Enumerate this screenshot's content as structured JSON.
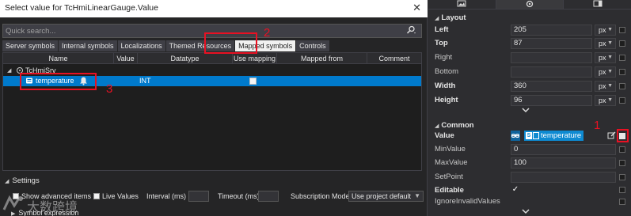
{
  "dialog": {
    "title": "Select value for TcHmiLinearGauge.Value",
    "close": "✕",
    "search_placeholder": "Quick search...",
    "search_icon": "search-icon",
    "tabs": [
      "Server symbols",
      "Internal symbols",
      "Localizations",
      "Themed Resources",
      "Mapped symbols",
      "Controls"
    ],
    "active_tab": "Mapped symbols",
    "columns": [
      "Name",
      "Value",
      "Datatype",
      "Use mapping",
      "Mapped from",
      "Comment"
    ],
    "tree": {
      "server": "TcHmiSrv",
      "symbol": "temperature",
      "datatype": "INT"
    },
    "settings": {
      "header": "Settings",
      "show_advanced": "Show advanced items",
      "live_values": "Live Values",
      "interval_label": "Interval (ms)",
      "timeout_label": "Timeout (ms)",
      "subscription_label": "Subscription Mode:",
      "subscription_value": "Use project default",
      "symbol_expression": "Symbol expression"
    }
  },
  "panel": {
    "tab_icons": [
      "image-icon",
      "settings-icon",
      "layout-icon"
    ],
    "layout": {
      "header": "Layout",
      "fields": [
        {
          "label": "Left",
          "value": "205",
          "unit": "px",
          "bold": true
        },
        {
          "label": "Top",
          "value": "87",
          "unit": "px",
          "bold": true
        },
        {
          "label": "Right",
          "value": "",
          "unit": "px",
          "bold": false
        },
        {
          "label": "Bottom",
          "value": "",
          "unit": "px",
          "bold": false
        },
        {
          "label": "Width",
          "value": "360",
          "unit": "px",
          "bold": true
        },
        {
          "label": "Height",
          "value": "96",
          "unit": "px",
          "bold": true
        }
      ]
    },
    "common": {
      "header": "Common",
      "value_label": "Value",
      "value_symbol": "temperature",
      "fields": [
        {
          "label": "MinValue",
          "value": "0"
        },
        {
          "label": "MaxValue",
          "value": "100"
        },
        {
          "label": "SetPoint",
          "value": ""
        },
        {
          "label": "Editable",
          "value": "✓"
        },
        {
          "label": "IgnoreInvalidValues",
          "value": ""
        }
      ]
    }
  },
  "annotations": [
    "1",
    "2",
    "3"
  ],
  "watermark": "大数跨境",
  "colors": {
    "accent": "#007acc",
    "annotation": "#e81123"
  }
}
